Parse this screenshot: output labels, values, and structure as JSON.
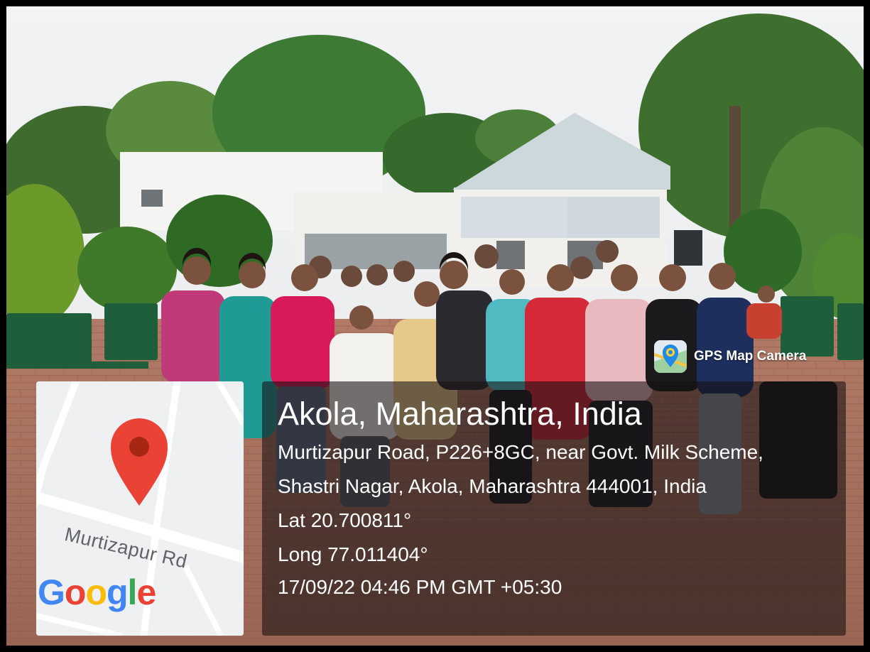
{
  "app": {
    "name": "GPS Map Camera",
    "icon": "map-pin-camera-icon"
  },
  "map": {
    "road_label": "Murtizapur Rd",
    "logo": [
      "G",
      "o",
      "o",
      "g",
      "l",
      "e"
    ],
    "logo_colors": [
      "#4285F4",
      "#EA4335",
      "#FBBC05",
      "#4285F4",
      "#34A853",
      "#EA4335"
    ],
    "pin_color": "#EA4335",
    "pin_icon": "location-pin-icon"
  },
  "location": {
    "title": "Akola, Maharashtra, India",
    "address_line1": "Murtizapur Road, P226+8GC, near Govt. Milk Scheme,",
    "address_line2": "Shastri Nagar, Akola, Maharashtra 444001, India",
    "latitude": "Lat 20.700811°",
    "longitude": "Long 77.011404°",
    "datetime": "17/09/22 04:46 PM GMT +05:30"
  }
}
